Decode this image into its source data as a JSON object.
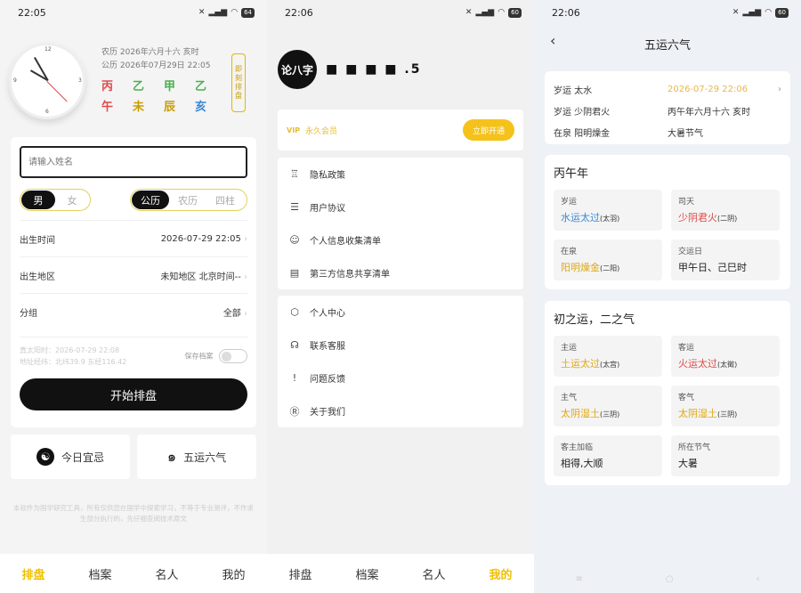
{
  "screens": {
    "home": {
      "time": "22:05",
      "battery": "64",
      "clock_numbers": [
        "12",
        "3",
        "6",
        "9"
      ],
      "lunar_line": "农历  2026年六月十六  亥时",
      "solar_line": "公历  2026年07月29日 22:05",
      "ganzhi": [
        {
          "t": "丙",
          "c": "#e04a4a"
        },
        {
          "t": "乙",
          "c": "#4cb050"
        },
        {
          "t": "甲",
          "c": "#4cb050"
        },
        {
          "t": "乙",
          "c": "#4cb050"
        },
        {
          "t": "午",
          "c": "#e04a4a"
        },
        {
          "t": "未",
          "c": "#c99c00"
        },
        {
          "t": "辰",
          "c": "#c99c00"
        },
        {
          "t": "亥",
          "c": "#3b87d6"
        }
      ],
      "vertical_badge": "即刻排盘",
      "name_placeholder": "请输入姓名",
      "gender": {
        "male": "男",
        "female": "女"
      },
      "calendar": {
        "solar": "公历",
        "lunar": "农历",
        "pillars": "四柱"
      },
      "rows": [
        {
          "label": "出生时间",
          "value": "2026-07-29 22:05"
        },
        {
          "label": "出生地区",
          "value": "未知地区 北京时间--"
        },
        {
          "label": "分组",
          "value": "全部"
        }
      ],
      "true_solar": "真太阳时：2026-07-29 22:08",
      "coords": "地址经纬：北纬39.9 东经116.42",
      "save_label": "保存档案",
      "start_button": "开始排盘",
      "quick1": "今日宜忌",
      "quick2": "五运六气",
      "disclaimer": "本软件为国学研究工具，所有仅供您在国学中探索学习，不等于专业测评，不作求生部分执行的，先仔细查阅技术原文",
      "tabs": [
        "排盘",
        "档案",
        "名人",
        "我的"
      ]
    },
    "me": {
      "time": "22:06",
      "battery": "60",
      "logo_text": "论八字",
      "username": "■ ■ ■ ■ .5",
      "vip_icon": "VIP",
      "vip_text": "永久会员",
      "vip_button": "立即开通",
      "menu1": [
        {
          "icon": "♖",
          "label": "隐私政策"
        },
        {
          "icon": "☰",
          "label": "用户协议"
        },
        {
          "icon": "☺",
          "label": "个人信息收集清单"
        },
        {
          "icon": "▤",
          "label": "第三方信息共享清单"
        }
      ],
      "menu2": [
        {
          "icon": "⬡",
          "label": "个人中心"
        },
        {
          "icon": "☊",
          "label": "联系客服"
        },
        {
          "icon": "!",
          "label": "问题反馈"
        },
        {
          "icon": "Ⓡ",
          "label": "关于我们"
        }
      ],
      "tabs": [
        "排盘",
        "档案",
        "名人",
        "我的"
      ]
    },
    "wuyun": {
      "time": "22:06",
      "battery": "60",
      "title": "五运六气",
      "info": [
        [
          "岁运  太水",
          "2026-07-29 22:06"
        ],
        [
          "岁运  少阴君火",
          "丙午年六月十六  亥时"
        ],
        [
          "在泉  阳明燥金",
          "大暑节气"
        ]
      ],
      "year_title": "丙午年",
      "year_tiles": [
        {
          "label": "岁运",
          "value": "水运太过",
          "note": "(太羽)",
          "color": "blue"
        },
        {
          "label": "司天",
          "value": "少阴君火",
          "note": "(二阴)",
          "color": "red"
        },
        {
          "label": "在泉",
          "value": "阳明燥金",
          "note": "(二阳)",
          "color": "gold"
        },
        {
          "label": "交运日",
          "value": "甲午日、己巳时",
          "note": "",
          "color": "dark"
        }
      ],
      "qi_title": "初之运，二之气",
      "qi_tiles": [
        {
          "label": "主运",
          "value": "土运太过",
          "note": "(太宫)",
          "color": "gold"
        },
        {
          "label": "客运",
          "value": "火运太过",
          "note": "(太徵)",
          "color": "red"
        },
        {
          "label": "主气",
          "value": "太阴湿土",
          "note": "(三阴)",
          "color": "gold"
        },
        {
          "label": "客气",
          "value": "太阴湿土",
          "note": "(三阴)",
          "color": "gold"
        },
        {
          "label": "客主加临",
          "value": "相得,大顺",
          "note": "",
          "color": "dark"
        },
        {
          "label": "所在节气",
          "value": "大暑",
          "note": "",
          "color": "dark"
        }
      ],
      "sys_nav": [
        "≡",
        "○",
        "‹"
      ]
    }
  }
}
